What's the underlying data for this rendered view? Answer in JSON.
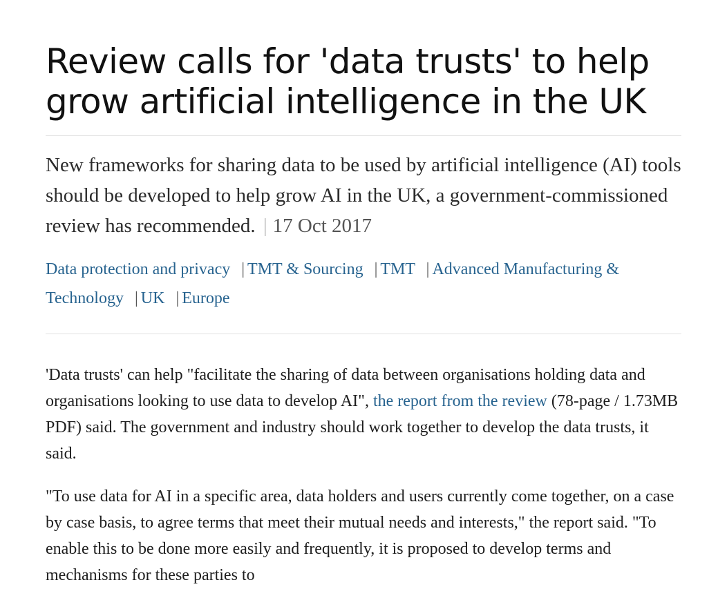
{
  "article": {
    "headline": "Review calls for 'data trusts' to help grow artificial intelligence in the UK",
    "standfirst": "New frameworks for sharing data to be used by artificial intelligence (AI) tools should be developed to help grow AI in the UK, a government-commissioned review has recommended.",
    "separator": "|",
    "date": "17 Oct 2017",
    "tags": [
      "Data protection and privacy",
      "TMT & Sourcing",
      "TMT",
      "Advanced Manufacturing & Technology",
      "UK",
      "Europe"
    ],
    "body": {
      "p1_before": "'Data trusts' can help \"facilitate the sharing of data between organisations holding data and organisations looking to use data to develop AI\", ",
      "p1_link": "the report from the review",
      "p1_after": " (78-page / 1.73MB PDF) said. The government and industry should work together to develop the data trusts, it said.",
      "p2": "\"To use data for AI in a specific area, data holders and users currently come together, on a case by case basis, to agree terms that meet their mutual needs and interests,\" the report said. \"To enable this to be done more easily and frequently, it is proposed to develop terms and mechanisms for these parties to"
    }
  },
  "colors": {
    "link": "#27638f",
    "text": "#1e1e1e",
    "rule": "#e2e2e2"
  }
}
